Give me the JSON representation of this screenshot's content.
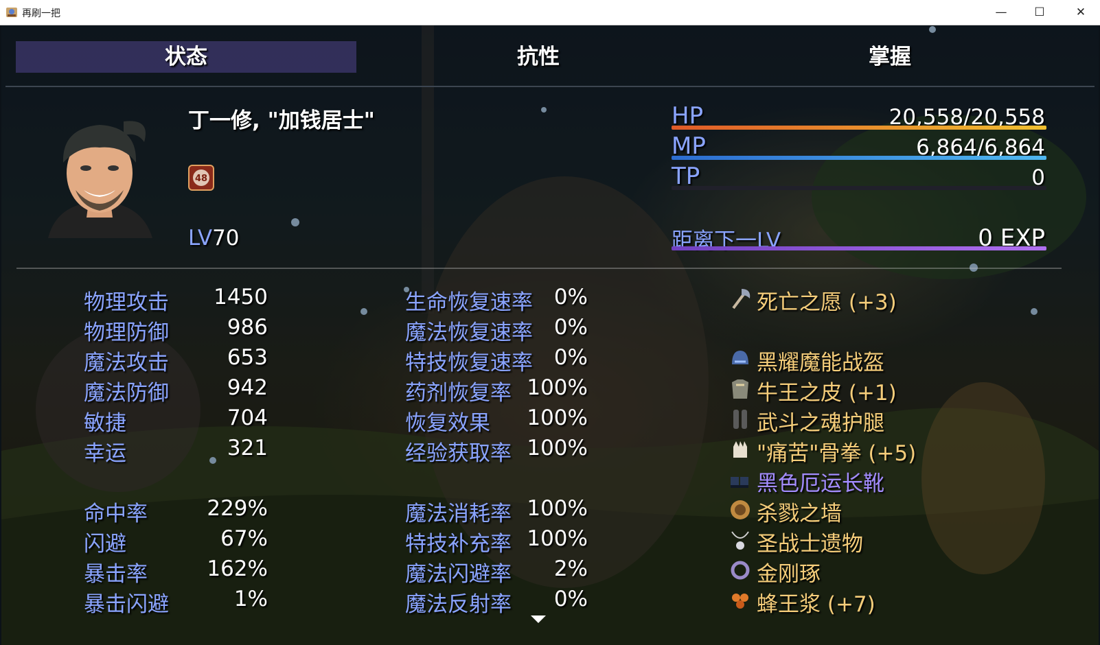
{
  "window": {
    "title": "再刷一把",
    "controls": {
      "minimize": "—",
      "maximize": "☐",
      "close": "✕"
    }
  },
  "tabs": [
    {
      "label": "状态",
      "active": true
    },
    {
      "label": "抗性",
      "active": false
    },
    {
      "label": "掌握",
      "active": false
    }
  ],
  "actor": {
    "name": "丁一修, \"加钱居士\"",
    "state_icon_text": "48",
    "level_label": "LV",
    "level": "70"
  },
  "gauges": {
    "hp": {
      "label": "HP",
      "value": "20,558/20,558",
      "fill": 1.0
    },
    "mp": {
      "label": "MP",
      "value": "6,864/6,864",
      "fill": 1.0
    },
    "tp": {
      "label": "TP",
      "value": "0",
      "fill": 0.0
    },
    "exp": {
      "label": "距离下一LV",
      "value": "0 EXP",
      "fill": 1.0
    }
  },
  "base_stats": [
    {
      "label": "物理攻击",
      "value": "1450"
    },
    {
      "label": "物理防御",
      "value": "986"
    },
    {
      "label": "魔法攻击",
      "value": "653"
    },
    {
      "label": "魔法防御",
      "value": "942"
    },
    {
      "label": "敏捷",
      "value": "704"
    },
    {
      "label": "幸运",
      "value": "321"
    }
  ],
  "ex_stats": [
    {
      "label": "命中率",
      "value": "229%"
    },
    {
      "label": "闪避",
      "value": "67%"
    },
    {
      "label": "暴击率",
      "value": "162%"
    },
    {
      "label": "暴击闪避",
      "value": "1%"
    }
  ],
  "regen_stats": [
    {
      "label": "生命恢复速率",
      "value": "0%"
    },
    {
      "label": "魔法恢复速率",
      "value": "0%"
    },
    {
      "label": "特技恢复速率",
      "value": "0%"
    },
    {
      "label": "药剂恢复率",
      "value": "100%"
    },
    {
      "label": "恢复效果",
      "value": "100%"
    },
    {
      "label": "经验获取率",
      "value": "100%"
    }
  ],
  "sp_stats": [
    {
      "label": "魔法消耗率",
      "value": "100%"
    },
    {
      "label": "特技补充率",
      "value": "100%"
    },
    {
      "label": "魔法闪避率",
      "value": "2%"
    },
    {
      "label": "魔法反射率",
      "value": "0%"
    }
  ],
  "equipment": [
    {
      "name": "死亡之愿 (+3)",
      "icon": "axe-icon"
    },
    {
      "name": "黑耀魔能战盔",
      "icon": "helmet-icon"
    },
    {
      "name": "牛王之皮 (+1)",
      "icon": "armor-icon"
    },
    {
      "name": "武斗之魂护腿",
      "icon": "greaves-icon"
    },
    {
      "name": "\"痛苦\"骨拳 (+5)",
      "icon": "gauntlet-icon"
    },
    {
      "name": "黑色厄运长靴",
      "icon": "boots-icon",
      "rarity_color": "#a38cff"
    },
    {
      "name": "杀戮之墙",
      "icon": "shield-icon"
    },
    {
      "name": "圣战士遗物",
      "icon": "amulet-icon"
    },
    {
      "name": "金刚琢",
      "icon": "ring-icon"
    },
    {
      "name": "蜂王浆 (+7)",
      "icon": "honey-icon"
    }
  ],
  "colors": {
    "label_blue": "#8aa4ff",
    "equip_gold": "#f5cd7a",
    "equip_purple": "#a38cff",
    "tab_active": "#50468c"
  }
}
